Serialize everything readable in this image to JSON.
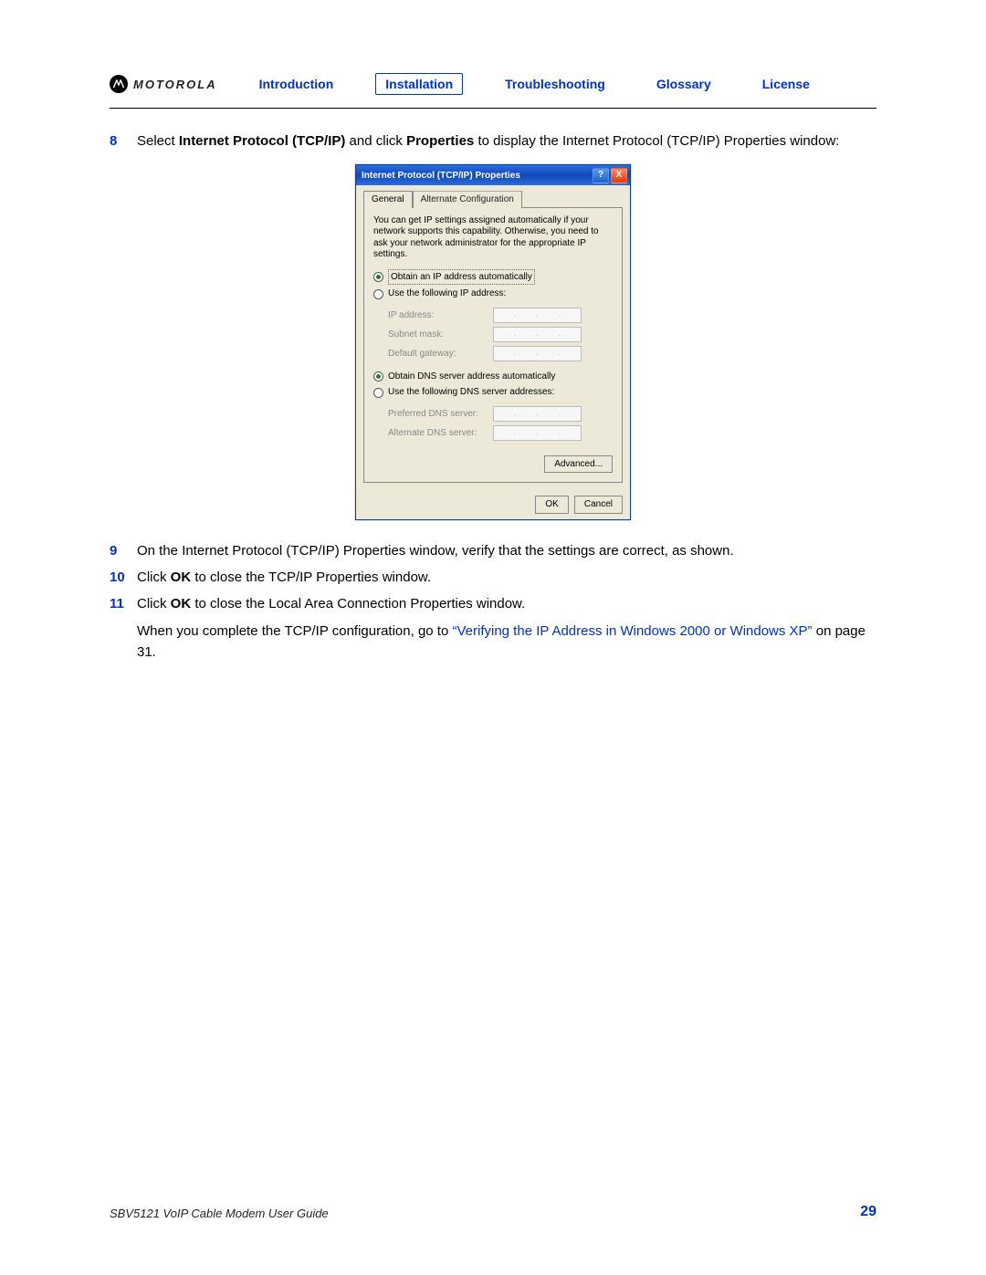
{
  "brand": "MOTOROLA",
  "nav": {
    "introduction": "Introduction",
    "installation": "Installation",
    "troubleshooting": "Troubleshooting",
    "glossary": "Glossary",
    "license": "License"
  },
  "steps": {
    "s8": {
      "num": "8",
      "pre": "Select ",
      "bold1": "Internet Protocol (TCP/IP)",
      "mid": " and click ",
      "bold2": "Properties",
      "post": " to display the Internet Protocol (TCP/IP) Properties window:"
    },
    "s9": {
      "num": "9",
      "text": "On the Internet Protocol (TCP/IP) Properties window, verify that the settings are correct, as shown."
    },
    "s10": {
      "num": "10",
      "pre": "Click ",
      "bold": "OK",
      "post": " to close the TCP/IP Properties window."
    },
    "s11": {
      "num": "11",
      "pre": "Click ",
      "bold": "OK",
      "post": " to close the Local Area Connection Properties window."
    },
    "final_pre": "When you complete the TCP/IP configuration, go to ",
    "final_link": "“Verifying the IP Address in Windows 2000 or Windows XP”",
    "final_post": " on page 31."
  },
  "dialog": {
    "title": "Internet Protocol (TCP/IP) Properties",
    "tab_general": "General",
    "tab_alt": "Alternate Configuration",
    "info": "You can get IP settings assigned automatically if your network supports this capability. Otherwise, you need to ask your network administrator for the appropriate IP settings.",
    "r_obtain_ip": "Obtain an IP address automatically",
    "r_use_ip": "Use the following IP address:",
    "lbl_ip": "IP address:",
    "lbl_subnet": "Subnet mask:",
    "lbl_gateway": "Default gateway:",
    "r_obtain_dns": "Obtain DNS server address automatically",
    "r_use_dns": "Use the following DNS server addresses:",
    "lbl_pref_dns": "Preferred DNS server:",
    "lbl_alt_dns": "Alternate DNS server:",
    "btn_advanced": "Advanced...",
    "btn_ok": "OK",
    "btn_cancel": "Cancel",
    "help_glyph": "?",
    "close_glyph": "X"
  },
  "footer": {
    "title": "SBV5121 VoIP Cable Modem User Guide",
    "page": "29"
  }
}
